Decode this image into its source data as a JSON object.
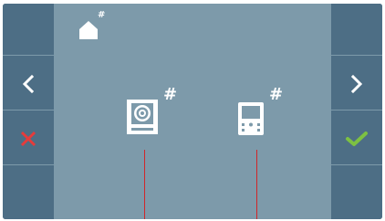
{
  "home": {
    "icon": "home-icon",
    "hash": "#"
  },
  "nav": {
    "prev_icon": "chevron-left-icon",
    "next_icon": "chevron-right-icon",
    "cancel_icon": "cross-icon",
    "confirm_icon": "check-icon"
  },
  "devices": [
    {
      "icon": "door-panel-icon",
      "hash": "#"
    },
    {
      "icon": "monitor-icon",
      "hash": "#"
    }
  ],
  "colors": {
    "screen_bg": "#7d9aaa",
    "side_panel": "#4d6e85",
    "cancel": "#e63b3b",
    "confirm": "#7dc142",
    "wire": "#d0262a"
  }
}
